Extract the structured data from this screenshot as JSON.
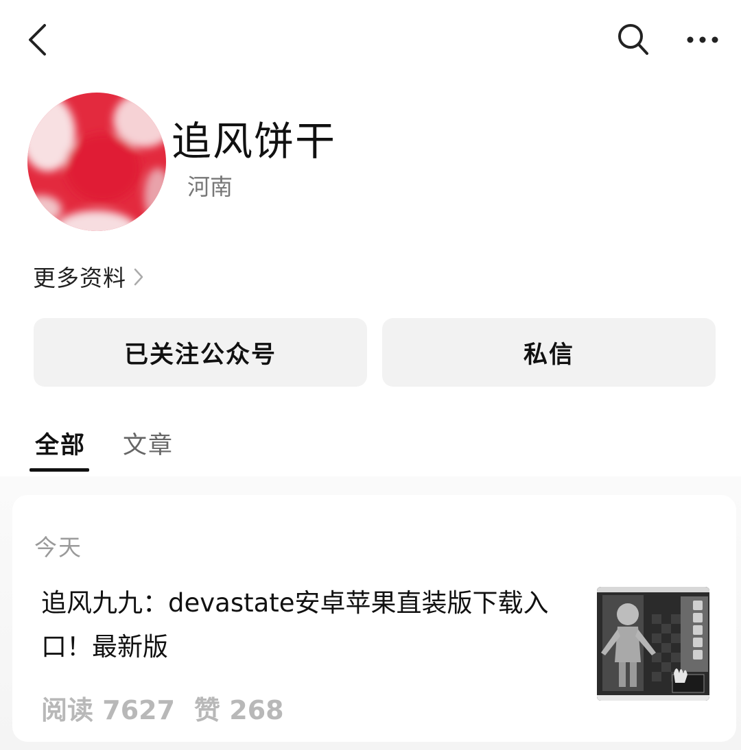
{
  "header": {
    "back_icon": "chevron-left-icon",
    "search_icon": "search-icon",
    "more_icon": "more-dots-icon"
  },
  "profile": {
    "name": "追风饼干",
    "region": "河南",
    "more_info_label": "更多资料",
    "avatar_colors": [
      "#e0283c",
      "#f6d4d6"
    ]
  },
  "actions": {
    "follow_label": "已关注公众号",
    "message_label": "私信"
  },
  "tabs": [
    {
      "label": "全部",
      "active": true
    },
    {
      "label": "文章",
      "active": false
    }
  ],
  "feed": {
    "date_label": "今天",
    "article": {
      "title": "追风九九：devastate安卓苹果直装版下载入口！最新版",
      "read_label": "阅读",
      "read_count": "7627",
      "like_label": "赞",
      "like_count": "268"
    }
  }
}
